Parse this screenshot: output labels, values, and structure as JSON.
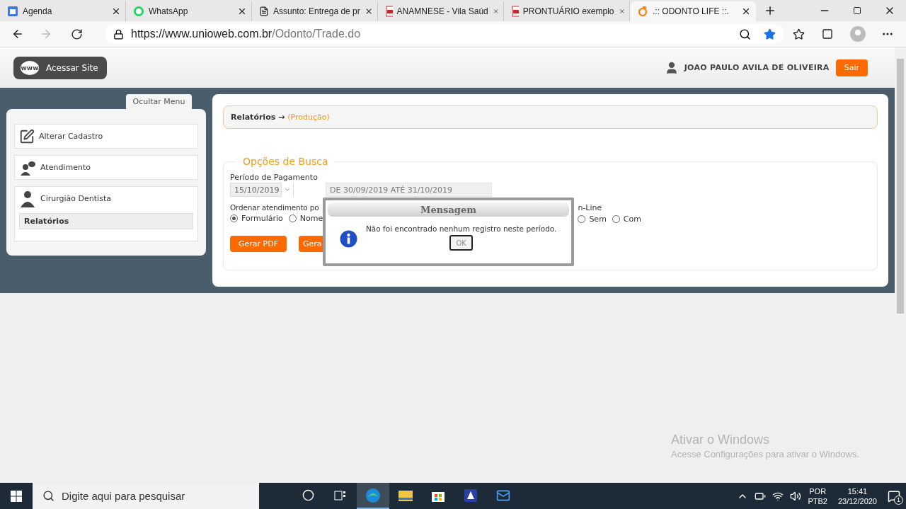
{
  "browser": {
    "tabs": [
      {
        "title": "Agenda",
        "kind": "calendar",
        "selected": false
      },
      {
        "title": "WhatsApp",
        "kind": "chat",
        "selected": false
      },
      {
        "title": "Assunto: Entrega de pr",
        "kind": "document",
        "selected": false
      },
      {
        "title": "ANAMNESE - Vila Saúd",
        "kind": "pdf",
        "selected": false
      },
      {
        "title": "PRONTUÁRIO exemplo",
        "kind": "pdf",
        "selected": false
      },
      {
        "title": ".:: ODONTO LIFE ::.",
        "kind": "swirl",
        "selected": true
      }
    ],
    "url_host": "https://www.unioweb.com.br",
    "url_path": "/Odonto/Trade.do"
  },
  "header": {
    "site_icon_text": "www",
    "site_button": "Acessar Site",
    "user_name": "JOAO PAULO AVILA DE OLIVEIRA",
    "logout": "Sair"
  },
  "sidebar": {
    "toggle": "Ocultar Menu",
    "items": [
      {
        "label": "Alterar Cadastro",
        "kind": "edit"
      },
      {
        "label": "Atendimento",
        "kind": "speech"
      },
      {
        "label": "Cirurgião Dentista",
        "kind": "person",
        "children": [
          {
            "label": "Relatórios",
            "selected": true
          }
        ]
      }
    ]
  },
  "breadcrumb": {
    "section": "Relatórios →",
    "current": "(Produção)"
  },
  "search": {
    "legend": "Opções de Busca",
    "period_label": "Período de Pagamento",
    "date_value": "15/10/2019",
    "range_value": "DE 30/09/2019 ATÉ 31/10/2019",
    "order_label": "Ordenar atendimento po",
    "order_options": [
      {
        "label": "Formulário",
        "selected": true
      },
      {
        "label": "Nome",
        "selected": false
      }
    ],
    "online_label": "n-Line",
    "online_options": [
      {
        "label": "Sem",
        "selected": false
      },
      {
        "label": "Com",
        "selected": false
      }
    ],
    "buttons": [
      "Gerar PDF",
      "Gera"
    ]
  },
  "dialog": {
    "title": "Mensagem",
    "message": "Não foi encontrado nenhum registro neste período.",
    "ok": "OK"
  },
  "activation": {
    "title": "Ativar o Windows",
    "subtitle": "Acesse Configurações para ativar o Windows."
  },
  "taskbar": {
    "search_placeholder": "Digite aqui para pesquisar",
    "apps": [
      {
        "kind": "cortana",
        "selected": false
      },
      {
        "kind": "taskview",
        "selected": false
      },
      {
        "kind": "edge",
        "selected": true
      },
      {
        "kind": "explorer",
        "selected": false
      },
      {
        "kind": "store",
        "selected": false
      },
      {
        "kind": "scanner",
        "selected": false
      },
      {
        "kind": "mail",
        "selected": false
      }
    ],
    "language": "POR",
    "layout": "PTB2",
    "time": "15:41",
    "date": "23/12/2020",
    "notifications": "1"
  }
}
